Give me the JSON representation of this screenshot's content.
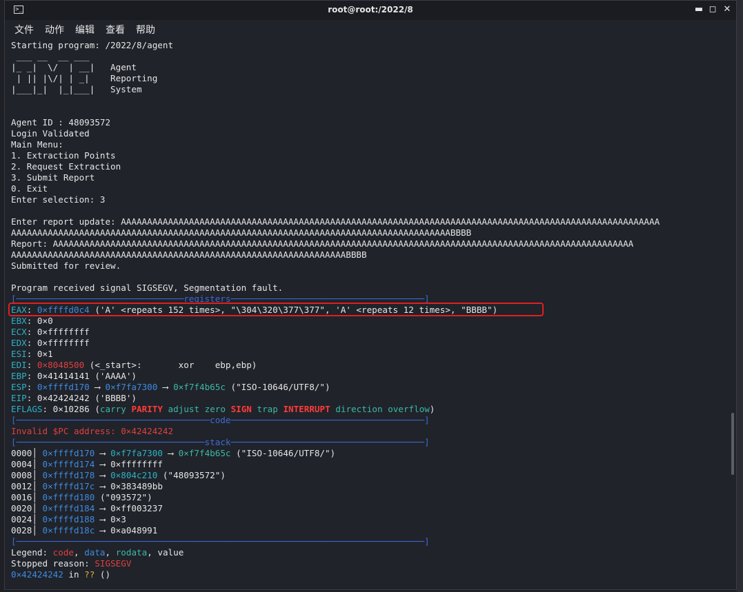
{
  "window": {
    "title": "root@root:/2022/8",
    "term_icon": "terminal-icon",
    "minimize": "▬",
    "maximize": "◻",
    "close": "✕"
  },
  "menu": [
    "文件",
    "动作",
    "编辑",
    "查看",
    "帮助"
  ],
  "terminal": {
    "start": "Starting program: /2022/8/agent",
    "banner": [
      " ___ __  __ ___",
      "|_ _|  \\/  | __|   Agent",
      " | || |\\/| | _|    Reporting",
      "|___|_|  |_|___|   System"
    ],
    "session": [
      "Agent ID : 48093572",
      "Login Validated",
      "Main Menu:",
      "1. Extraction Points",
      "2. Request Extraction",
      "3. Submit Report",
      "0. Exit",
      "Enter selection: 3"
    ],
    "report_input_1": "Enter report update: AAAAAAAAAAAAAAAAAAAAAAAAAAAAAAAAAAAAAAAAAAAAAAAAAAAAAAAAAAAAAAAAAAAAAAAAAAAAAAAAAAAAAAAAAAAAAAAAAAAAAAA",
    "report_input_2": "AAAAAAAAAAAAAAAAAAAAAAAAAAAAAAAAAAAAAAAAAAAAAAAAAAAAAAAAAAAAAAAAAAAAAAAAAAAAAAAAAAAABBBB",
    "report_echo_1": "Report: AAAAAAAAAAAAAAAAAAAAAAAAAAAAAAAAAAAAAAAAAAAAAAAAAAAAAAAAAAAAAAAAAAAAAAAAAAAAAAAAAAAAAAAAAAAAAAAAAAAAAAAAAAAAAAA",
    "report_echo_2": "AAAAAAAAAAAAAAAAAAAAAAAAAAAAAAAAAAAAAAAAAAAAAAAAAAAAAAAAAAAAAAAABBBB",
    "submitted": "Submitted for review.",
    "signal": "Program received signal SIGSEGV, Segmentation fault.",
    "registers_header": "[────────────────────────────────registers─────────────────────────────────────]",
    "registers": [
      {
        "name": "EAX",
        "addr": "0×ffffd0c4",
        "rest": " ('A' <repeats 152 times>, \"\\304\\320\\377\\377\", 'A' <repeats 12 times>, \"BBBB\")"
      },
      {
        "name": "EBX",
        "value": "0×0"
      },
      {
        "name": "ECX",
        "value": "0×ffffffff"
      },
      {
        "name": "EDX",
        "value": "0×ffffffff"
      },
      {
        "name": "ESI",
        "value": "0×1"
      },
      {
        "name": "EDI",
        "addr": "0×8048500",
        "rest": " (<_start>:       xor    ebp,ebp)"
      },
      {
        "name": "EBP",
        "value": "0×41414141 ('AAAA')"
      },
      {
        "name": "ESP",
        "addr": "0×ffffd170",
        "arrow": " ⟶ ",
        "addr2": "0×f7fa7300",
        "arrow2": " ⟶ ",
        "addr3": "0×f7f4b65c",
        "rest": " (\"ISO-10646/UTF8/\")"
      },
      {
        "name": "EIP",
        "value": "0×42424242 ('BBBB')"
      }
    ],
    "eflags": {
      "label": "EFLAGS",
      "value": "0×10286",
      "flags": [
        {
          "t": "carry",
          "on": false
        },
        {
          "t": "PARITY",
          "on": true
        },
        {
          "t": "adjust",
          "on": false
        },
        {
          "t": "zero",
          "on": false
        },
        {
          "t": "SIGN",
          "on": true
        },
        {
          "t": "trap",
          "on": false
        },
        {
          "t": "INTERRUPT",
          "on": true
        },
        {
          "t": "direction",
          "on": false
        },
        {
          "t": "overflow",
          "on": false
        }
      ]
    },
    "code_header": "[─────────────────────────────────────code─────────────────────────────────────]",
    "invalid_pc": "Invalid $PC address: 0×42424242",
    "stack_header": "[────────────────────────────────────stack─────────────────────────────────────]",
    "stack": [
      {
        "off": "0000",
        "addr": "0×ffffd170",
        "chain": [
          {
            "c": "cyan",
            "t": "0×f7fa7300"
          },
          {
            "c": "white",
            "t": " ⟶ "
          },
          {
            "c": "green",
            "t": "0×f7f4b65c"
          },
          {
            "c": "white",
            "t": " (\"ISO-10646/UTF8/\")"
          }
        ]
      },
      {
        "off": "0004",
        "addr": "0×ffffd174",
        "chain": [
          {
            "c": "white",
            "t": "0×ffffffff"
          }
        ]
      },
      {
        "off": "0008",
        "addr": "0×ffffd178",
        "chain": [
          {
            "c": "cyan",
            "t": "0×804c210"
          },
          {
            "c": "white",
            "t": " (\"48093572\")"
          }
        ]
      },
      {
        "off": "0012",
        "addr": "0×ffffd17c",
        "chain": [
          {
            "c": "white",
            "t": "0×383489bb"
          }
        ]
      },
      {
        "off": "0016",
        "addr": "0×ffffd180",
        "chain": [
          {
            "c": "white",
            "t": "(\"093572\")"
          }
        ],
        "no_arrow": true
      },
      {
        "off": "0020",
        "addr": "0×ffffd184",
        "chain": [
          {
            "c": "white",
            "t": "0×ff003237"
          }
        ]
      },
      {
        "off": "0024",
        "addr": "0×ffffd188",
        "chain": [
          {
            "c": "white",
            "t": "0×3"
          }
        ]
      },
      {
        "off": "0028",
        "addr": "0×ffffd18c",
        "chain": [
          {
            "c": "white",
            "t": "0×a048991"
          }
        ]
      }
    ],
    "end_rule": "[──────────────────────────────────────────────────────────────────────────────]",
    "legend": {
      "label": "Legend: ",
      "code": "code",
      "data": "data",
      "rodata": "rodata",
      "value": "value"
    },
    "stopped": {
      "label": "Stopped reason: ",
      "reason": "SIGSEGV"
    },
    "final": {
      "addr": "0×42424242",
      "in": " in ",
      "fn": "??",
      "parens": " ()"
    }
  }
}
